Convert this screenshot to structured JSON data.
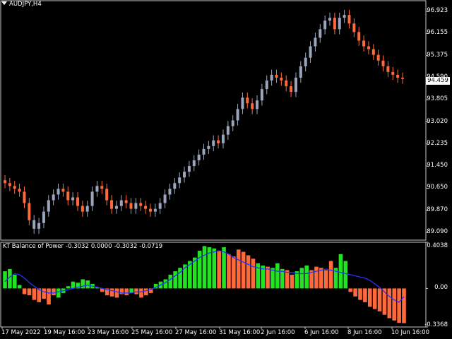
{
  "window": {
    "symbol_label": "AUDJPY,H4",
    "current_price": "94.459",
    "colors": {
      "background": "#000000",
      "frame": "#c8c8c8",
      "bull_candle": "#9aa6bd",
      "bear_candle": "#ff6a3d",
      "bop_positive": "#22e322",
      "bop_negative": "#ff6a3d",
      "bop_signal": "#2233ff"
    }
  },
  "price_axis": {
    "labels": [
      "96.923",
      "96.155",
      "95.375",
      "94.590",
      "93.805",
      "93.020",
      "92.235",
      "91.450",
      "90.650",
      "89.870",
      "89.090"
    ]
  },
  "indicator": {
    "name": "KT Balance of Power",
    "v1": "-0.3032",
    "v2": "0.0000",
    "v3": "-0.3032",
    "v4": "-0.0719",
    "axis_labels": [
      "0.4038",
      "0.00",
      "-0.3368"
    ]
  },
  "time_axis": {
    "labels": [
      "17 May 2022",
      "19 May 16:00",
      "23 May 16:00",
      "25 May 16:00",
      "27 May 16:00",
      "31 May 16:00",
      "2 Jun 16:00",
      "6 Jun 16:00",
      "8 Jun 16:00",
      "10 Jun 16:00"
    ]
  },
  "chart_data": [
    {
      "type": "candlestick",
      "title": "AUDJPY,H4",
      "y_range": [
        88.8,
        97.2
      ],
      "close_series": [
        90.8,
        90.7,
        90.6,
        90.5,
        90.1,
        89.5,
        89.2,
        89.4,
        89.8,
        90.2,
        90.4,
        90.6,
        90.5,
        90.2,
        90.3,
        90.0,
        89.8,
        90.0,
        90.5,
        90.7,
        90.6,
        90.2,
        89.9,
        90.0,
        90.2,
        90.1,
        89.9,
        90.1,
        90.0,
        89.9,
        89.8,
        89.9,
        90.1,
        90.4,
        90.6,
        90.8,
        91.0,
        91.2,
        91.4,
        91.6,
        91.8,
        92.0,
        92.1,
        92.3,
        92.2,
        92.5,
        92.8,
        93.0,
        93.4,
        93.8,
        93.6,
        93.4,
        93.7,
        94.1,
        94.4,
        94.6,
        94.5,
        94.4,
        94.2,
        94.0,
        94.5,
        94.9,
        95.2,
        95.6,
        95.9,
        96.2,
        96.5,
        96.6,
        96.2,
        96.6,
        96.7,
        96.4,
        96.1,
        95.8,
        95.6,
        95.5,
        95.3,
        95.1,
        94.9,
        94.7,
        94.6,
        94.5,
        94.46
      ],
      "direction": [
        "down",
        "down",
        "down",
        "down",
        "down",
        "down",
        "up",
        "up",
        "up",
        "up",
        "up",
        "up",
        "down",
        "down",
        "up",
        "down",
        "down",
        "up",
        "up",
        "up",
        "down",
        "down",
        "down",
        "up",
        "up",
        "down",
        "down",
        "up",
        "down",
        "down",
        "down",
        "up",
        "up",
        "up",
        "up",
        "up",
        "up",
        "up",
        "up",
        "up",
        "up",
        "up",
        "up",
        "up",
        "down",
        "up",
        "up",
        "up",
        "up",
        "up",
        "down",
        "down",
        "up",
        "up",
        "up",
        "up",
        "down",
        "down",
        "down",
        "down",
        "up",
        "up",
        "up",
        "up",
        "up",
        "up",
        "up",
        "up",
        "down",
        "up",
        "up",
        "down",
        "down",
        "down",
        "down",
        "down",
        "down",
        "down",
        "down",
        "down",
        "down",
        "down",
        "down"
      ]
    },
    {
      "type": "bar",
      "title": "KT Balance of Power",
      "y_range": [
        -0.3368,
        0.4038
      ],
      "bar_values": [
        0.15,
        0.17,
        0.12,
        0.03,
        -0.05,
        -0.06,
        -0.1,
        -0.12,
        -0.09,
        -0.14,
        -0.06,
        -0.08,
        -0.04,
        0.02,
        0.06,
        0.05,
        0.08,
        0.07,
        0.04,
        0.01,
        -0.03,
        -0.06,
        -0.07,
        -0.08,
        -0.05,
        -0.06,
        -0.04,
        -0.05,
        -0.08,
        -0.06,
        -0.04,
        0.04,
        0.06,
        0.08,
        0.12,
        0.15,
        0.18,
        0.21,
        0.24,
        0.27,
        0.33,
        0.37,
        0.36,
        0.35,
        0.33,
        0.36,
        0.3,
        0.28,
        0.34,
        0.32,
        0.29,
        0.26,
        0.22,
        0.2,
        0.19,
        0.18,
        0.22,
        0.17,
        0.16,
        0.12,
        0.15,
        0.18,
        0.2,
        0.16,
        0.19,
        0.18,
        0.16,
        0.24,
        0.18,
        0.3,
        0.24,
        -0.03,
        -0.07,
        -0.1,
        -0.12,
        -0.16,
        -0.18,
        -0.2,
        -0.23,
        -0.26,
        -0.28,
        -0.3,
        -0.3032
      ],
      "bar_direction": [
        "pos",
        "pos",
        "pos",
        "pos",
        "neg",
        "neg",
        "neg",
        "neg",
        "neg",
        "neg",
        "neg",
        "pos",
        "pos",
        "pos",
        "pos",
        "pos",
        "pos",
        "pos",
        "pos",
        "pos",
        "neg",
        "neg",
        "neg",
        "neg",
        "neg",
        "neg",
        "pos",
        "neg",
        "neg",
        "neg",
        "neg",
        "pos",
        "pos",
        "pos",
        "pos",
        "pos",
        "pos",
        "pos",
        "pos",
        "pos",
        "pos",
        "pos",
        "pos",
        "pos",
        "neg",
        "pos",
        "neg",
        "neg",
        "neg",
        "neg",
        "neg",
        "neg",
        "pos",
        "pos",
        "neg",
        "pos",
        "pos",
        "pos",
        "neg",
        "neg",
        "pos",
        "pos",
        "pos",
        "neg",
        "neg",
        "neg",
        "neg",
        "neg",
        "pos",
        "pos",
        "pos",
        "neg",
        "neg",
        "neg",
        "neg",
        "neg",
        "neg",
        "neg",
        "neg",
        "neg",
        "neg",
        "neg",
        "neg"
      ],
      "signal_values": [
        0.06,
        0.1,
        0.13,
        0.12,
        0.09,
        0.05,
        0.02,
        -0.01,
        -0.03,
        -0.04,
        -0.04,
        -0.03,
        -0.02,
        -0.01,
        0.0,
        0.01,
        0.02,
        0.03,
        0.02,
        0.01,
        0.0,
        -0.01,
        -0.02,
        -0.03,
        -0.04,
        -0.04,
        -0.04,
        -0.03,
        -0.03,
        -0.02,
        -0.01,
        0.01,
        0.03,
        0.05,
        0.08,
        0.11,
        0.14,
        0.18,
        0.21,
        0.24,
        0.27,
        0.29,
        0.31,
        0.32,
        0.33,
        0.32,
        0.3,
        0.27,
        0.25,
        0.23,
        0.21,
        0.19,
        0.18,
        0.17,
        0.17,
        0.16,
        0.15,
        0.15,
        0.14,
        0.14,
        0.13,
        0.13,
        0.13,
        0.14,
        0.15,
        0.16,
        0.17,
        0.16,
        0.15,
        0.14,
        0.13,
        0.12,
        0.11,
        0.1,
        0.09,
        0.07,
        0.04,
        0.01,
        -0.03,
        -0.07,
        -0.1,
        -0.12,
        -0.0719
      ]
    }
  ]
}
